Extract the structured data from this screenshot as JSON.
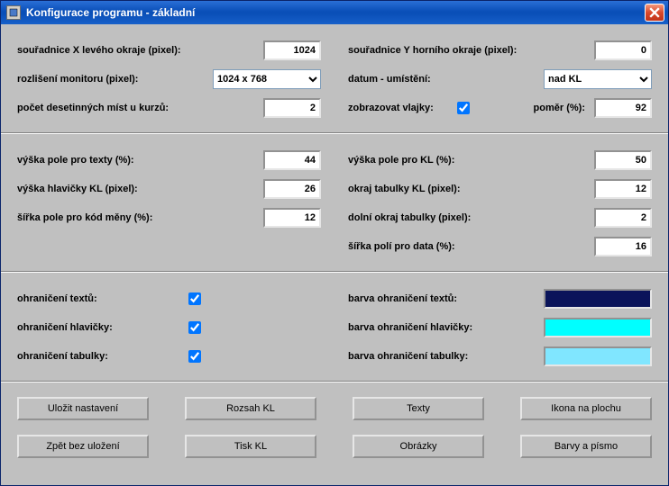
{
  "window": {
    "title": "Konfigurace programu - základní"
  },
  "sec1": {
    "coordX_label": "souřadnice X  levého okraje (pixel):",
    "coordX_value": "1024",
    "coordY_label": "souřadnice Y horního okraje (pixel):",
    "coordY_value": "0",
    "resolution_label": "rozlišení monitoru (pixel):",
    "resolution_value": "1024 x 768",
    "date_pos_label": "datum - umístění:",
    "date_pos_value": "nad KL",
    "decimals_label": "počet desetinných míst u kurzů:",
    "decimals_value": "2",
    "show_flags_label": "zobrazovat vlajky:",
    "show_flags_checked": true,
    "ratio_label": "poměr (%):",
    "ratio_value": "92"
  },
  "sec2": {
    "text_field_height_label": "výška pole pro texty (%):",
    "text_field_height_value": "44",
    "kl_header_height_label": "výška hlavičky KL (pixel):",
    "kl_header_height_value": "26",
    "currency_code_width_label": "šířka pole pro kód měny (%):",
    "currency_code_width_value": "12",
    "kl_field_height_label": "výška pole pro KL (%):",
    "kl_field_height_value": "50",
    "kl_table_margin_label": "okraj tabulky KL (pixel):",
    "kl_table_margin_value": "12",
    "table_bottom_margin_label": "dolní okraj tabulky (pixel):",
    "table_bottom_margin_value": "2",
    "data_field_width_label": "šířka polí pro data (%):",
    "data_field_width_value": "16"
  },
  "sec3": {
    "border_text_label": "ohraničení textů:",
    "border_text_checked": true,
    "border_header_label": "ohraničení hlavičky:",
    "border_header_checked": true,
    "border_table_label": "ohraničení tabulky:",
    "border_table_checked": true,
    "color_text_label": "barva ohraničení textů:",
    "color_text_value": "#0a145a",
    "color_header_label": "barva ohraničení hlavičky:",
    "color_header_value": "#00ffff",
    "color_table_label": "barva ohraničení tabulky:",
    "color_table_value": "#80e6ff"
  },
  "buttons": {
    "save": "Uložit nastavení",
    "range": "Rozsah KL",
    "texts": "Texty",
    "icon_desktop": "Ikona na plochu",
    "back": "Zpět bez uložení",
    "print": "Tisk KL",
    "images": "Obrázky",
    "colors_font": "Barvy a písmo"
  }
}
